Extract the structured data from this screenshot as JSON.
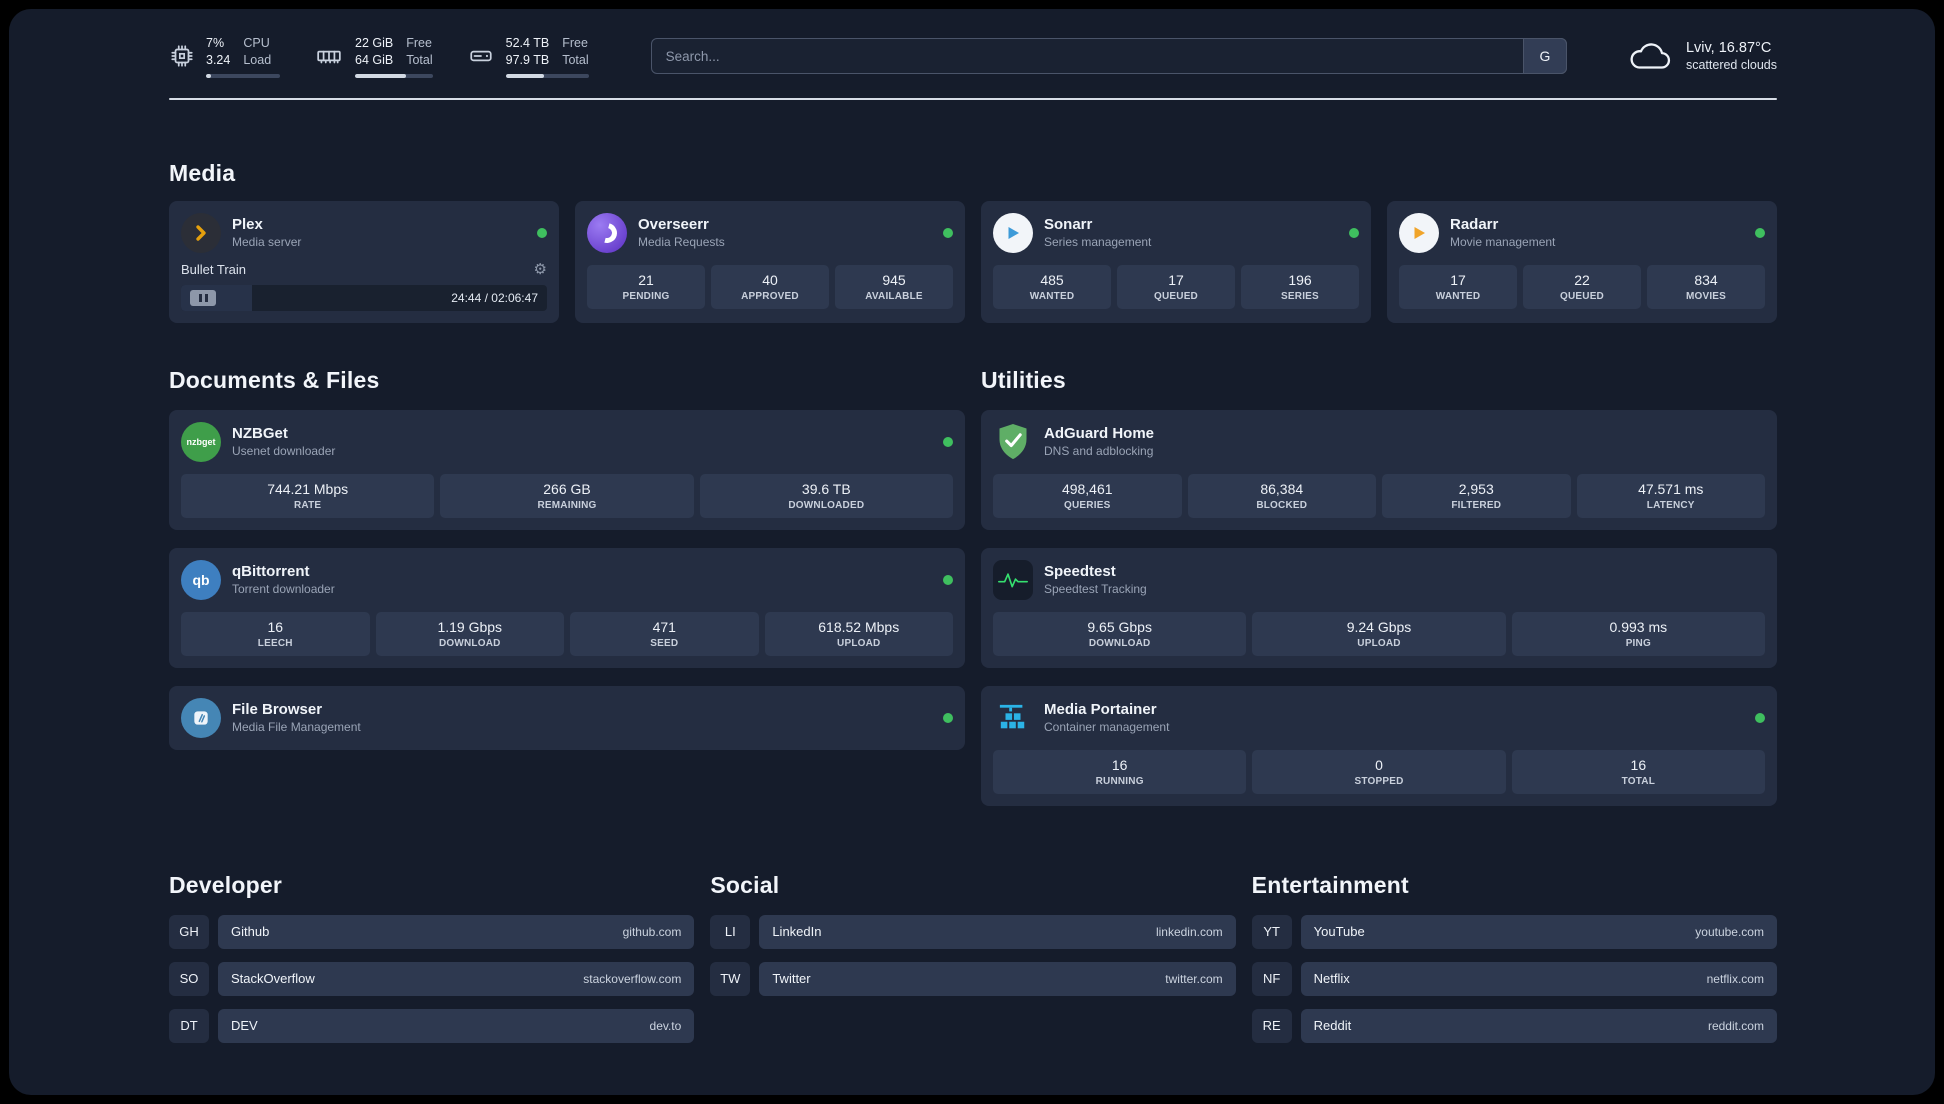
{
  "topbar": {
    "cpu": {
      "value_top": "7%",
      "value_bottom": "3.24",
      "label_top": "CPU",
      "label_bottom": "Load",
      "bar_percent": 7
    },
    "ram": {
      "value_top": "22 GiB",
      "value_bottom": "64 GiB",
      "label_top": "Free",
      "label_bottom": "Total",
      "bar_percent": 66
    },
    "disk": {
      "value_top": "52.4 TB",
      "value_bottom": "97.9 TB",
      "label_top": "Free",
      "label_bottom": "Total",
      "bar_percent": 46
    },
    "search": {
      "placeholder": "Search...",
      "engine_label": "G"
    },
    "weather": {
      "location": "Lviv, 16.87°C",
      "condition": "scattered clouds"
    }
  },
  "sections": {
    "media": "Media",
    "documents": "Documents & Files",
    "utilities": "Utilities",
    "developer": "Developer",
    "social": "Social",
    "entertainment": "Entertainment"
  },
  "icons": {
    "gear": "⚙"
  },
  "apps": {
    "plex": {
      "name": "Plex",
      "subtitle": "Media server",
      "online": true,
      "now_playing": "Bullet Train",
      "time": "24:44 / 02:06:47",
      "progress_percent": 19.5
    },
    "overseerr": {
      "name": "Overseerr",
      "subtitle": "Media Requests",
      "online": true,
      "stats": [
        {
          "value": "21",
          "label": "PENDING"
        },
        {
          "value": "40",
          "label": "APPROVED"
        },
        {
          "value": "945",
          "label": "AVAILABLE"
        }
      ]
    },
    "sonarr": {
      "name": "Sonarr",
      "subtitle": "Series management",
      "online": true,
      "stats": [
        {
          "value": "485",
          "label": "WANTED"
        },
        {
          "value": "17",
          "label": "QUEUED"
        },
        {
          "value": "196",
          "label": "SERIES"
        }
      ]
    },
    "radarr": {
      "name": "Radarr",
      "subtitle": "Movie management",
      "online": true,
      "stats": [
        {
          "value": "17",
          "label": "WANTED"
        },
        {
          "value": "22",
          "label": "QUEUED"
        },
        {
          "value": "834",
          "label": "MOVIES"
        }
      ]
    },
    "nzbget": {
      "name": "NZBGet",
      "subtitle": "Usenet downloader",
      "online": true,
      "icon_text": "nzbget",
      "stats": [
        {
          "value": "744.21 Mbps",
          "label": "RATE"
        },
        {
          "value": "266 GB",
          "label": "REMAINING"
        },
        {
          "value": "39.6 TB",
          "label": "DOWNLOADED"
        }
      ]
    },
    "qbittorrent": {
      "name": "qBittorrent",
      "subtitle": "Torrent downloader",
      "online": true,
      "icon_text": "qb",
      "stats": [
        {
          "value": "16",
          "label": "LEECH"
        },
        {
          "value": "1.19 Gbps",
          "label": "DOWNLOAD"
        },
        {
          "value": "471",
          "label": "SEED"
        },
        {
          "value": "618.52 Mbps",
          "label": "UPLOAD"
        }
      ]
    },
    "filebrowser": {
      "name": "File Browser",
      "subtitle": "Media File Management",
      "online": true
    },
    "adguard": {
      "name": "AdGuard Home",
      "subtitle": "DNS and adblocking",
      "stats": [
        {
          "value": "498,461",
          "label": "QUERIES"
        },
        {
          "value": "86,384",
          "label": "BLOCKED"
        },
        {
          "value": "2,953",
          "label": "FILTERED"
        },
        {
          "value": "47.571 ms",
          "label": "LATENCY"
        }
      ]
    },
    "speedtest": {
      "name": "Speedtest",
      "subtitle": "Speedtest Tracking",
      "stats": [
        {
          "value": "9.65 Gbps",
          "label": "DOWNLOAD"
        },
        {
          "value": "9.24 Gbps",
          "label": "UPLOAD"
        },
        {
          "value": "0.993 ms",
          "label": "PING"
        }
      ]
    },
    "portainer": {
      "name": "Media Portainer",
      "subtitle": "Container management",
      "online": true,
      "stats": [
        {
          "value": "16",
          "label": "RUNNING"
        },
        {
          "value": "0",
          "label": "STOPPED"
        },
        {
          "value": "16",
          "label": "TOTAL"
        }
      ]
    }
  },
  "bookmarks": {
    "developer": [
      {
        "abbr": "GH",
        "name": "Github",
        "domain": "github.com"
      },
      {
        "abbr": "SO",
        "name": "StackOverflow",
        "domain": "stackoverflow.com"
      },
      {
        "abbr": "DT",
        "name": "DEV",
        "domain": "dev.to"
      }
    ],
    "social": [
      {
        "abbr": "LI",
        "name": "LinkedIn",
        "domain": "linkedin.com"
      },
      {
        "abbr": "TW",
        "name": "Twitter",
        "domain": "twitter.com"
      }
    ],
    "entertainment": [
      {
        "abbr": "YT",
        "name": "YouTube",
        "domain": "youtube.com"
      },
      {
        "abbr": "NF",
        "name": "Netflix",
        "domain": "netflix.com"
      },
      {
        "abbr": "RE",
        "name": "Reddit",
        "domain": "reddit.com"
      }
    ]
  },
  "colors": {
    "status_online": "#3fbf5f",
    "background": "#151c2b",
    "card": "#242d41",
    "tile": "#2e3950"
  }
}
